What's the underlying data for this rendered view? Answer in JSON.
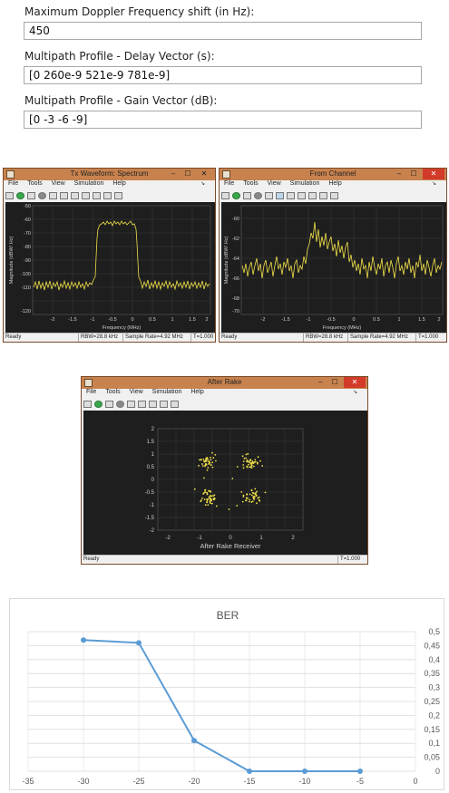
{
  "form": {
    "doppler_label": "Maximum Doppler Frequency shift (in Hz):",
    "doppler_value": "450",
    "delay_label": "Multipath Profile - Delay Vector (s):",
    "delay_value": "[0 260e-9 521e-9 781e-9]",
    "gain_label": "Multipath Profile - Gain Vector (dB):",
    "gain_value": "[0 -3 -6 -9]"
  },
  "windows": {
    "tx": {
      "title": "Tx Waveform: Spectrum",
      "menu": [
        "File",
        "Tools",
        "View",
        "Simulation",
        "Help"
      ],
      "status": "Ready",
      "rbw": "RBW=28.8 kHz",
      "sample_rate": "Sample Rate=4.92 MHz",
      "time": "T=1.000",
      "xlabel": "Frequency (MHz)",
      "ylabel": "Magnitude (dBW/ Hz)",
      "xticks": [
        "-2",
        "-1.5",
        "-1",
        "-0.5",
        "0",
        "0.5",
        "1",
        "1.5",
        "2"
      ],
      "yticks": [
        "-50",
        "-60",
        "-70",
        "-80",
        "-90",
        "-100",
        "-110",
        "-120"
      ]
    },
    "channel": {
      "title": "From Channel",
      "menu": [
        "File",
        "Tools",
        "View",
        "Simulation",
        "Help"
      ],
      "status": "Ready",
      "rbw": "RBW=28.8 kHz",
      "sample_rate": "Sample Rate=4.92 MHz",
      "time": "T=1.000",
      "xlabel": "Frequency (MHz)",
      "ylabel": "Magnitude (dBW/ Hz)",
      "xticks": [
        "-2",
        "-1.5",
        "-1",
        "-0.5",
        "0",
        "0.5",
        "1",
        "1.5",
        "2"
      ],
      "yticks": [
        "-60",
        "-62",
        "-64",
        "-66",
        "-68",
        "-70"
      ]
    },
    "rake": {
      "title": "After Rake",
      "menu": [
        "File",
        "Tools",
        "View",
        "Simulation",
        "Help"
      ],
      "status": "Ready",
      "time": "T=1.000",
      "xlabel": "After Rake Receiver",
      "xticks": [
        "-2",
        "-1",
        "0",
        "1",
        "2"
      ],
      "yticks": [
        "2",
        "1.5",
        "1",
        "0.5",
        "0",
        "-0.5",
        "-1",
        "-1.5",
        "-2"
      ]
    }
  },
  "chart_data": {
    "type": "line",
    "title": "BER",
    "x": [
      -30,
      -25,
      -20,
      -15,
      -10,
      -5
    ],
    "series": [
      {
        "values": [
          0.47,
          0.46,
          0.11,
          0.0,
          0.0,
          0.0
        ],
        "color": "#5b9bd5"
      }
    ],
    "xlim": [
      -35,
      0
    ],
    "ylim": [
      0,
      0.5
    ],
    "xticks": [
      "-35",
      "-30",
      "-25",
      "-20",
      "-15",
      "-10",
      "-5",
      "0"
    ],
    "yticks": [
      "0",
      "0,05",
      "0,1",
      "0,15",
      "0,2",
      "0,25",
      "0,3",
      "0,35",
      "0,4",
      "0,45",
      "0,5"
    ],
    "grid": true
  }
}
